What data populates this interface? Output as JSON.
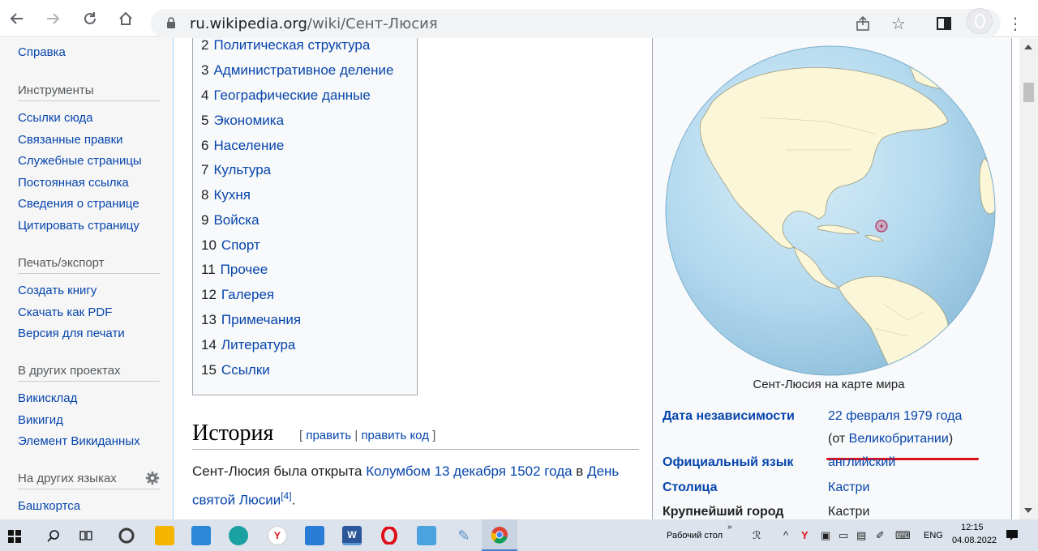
{
  "browser": {
    "url_domain": "ru.wikipedia.org",
    "url_path": "/wiki/Сент-Люсия"
  },
  "sidebar": {
    "help": "Справка",
    "tools_title": "Инструменты",
    "tools": [
      "Ссылки сюда",
      "Связанные правки",
      "Служебные страницы",
      "Постоянная ссылка",
      "Сведения о странице",
      "Цитировать страницу"
    ],
    "print_title": "Печать/экспорт",
    "print": [
      "Создать книгу",
      "Скачать как PDF",
      "Версия для печати"
    ],
    "projects_title": "В других проектах",
    "projects": [
      "Викисклад",
      "Викигид",
      "Элемент Викиданных"
    ],
    "languages_title": "На других языках",
    "languages": [
      "Башҡортса"
    ]
  },
  "toc": [
    {
      "num": "2",
      "text": "Политическая структура"
    },
    {
      "num": "3",
      "text": "Административное деление"
    },
    {
      "num": "4",
      "text": "Географические данные"
    },
    {
      "num": "5",
      "text": "Экономика"
    },
    {
      "num": "6",
      "text": "Население"
    },
    {
      "num": "7",
      "text": "Культура"
    },
    {
      "num": "8",
      "text": "Кухня"
    },
    {
      "num": "9",
      "text": "Войска"
    },
    {
      "num": "10",
      "text": "Спорт"
    },
    {
      "num": "11",
      "text": "Прочее"
    },
    {
      "num": "12",
      "text": "Галерея"
    },
    {
      "num": "13",
      "text": "Примечания"
    },
    {
      "num": "14",
      "text": "Литература"
    },
    {
      "num": "15",
      "text": "Ссылки"
    }
  ],
  "section": {
    "title": "История",
    "edit_open": "[",
    "edit": "править",
    "edit_sep": "|",
    "edit_code": "править код",
    "edit_close": "]"
  },
  "paragraph": {
    "t1": "Сент-Люсия была открыта ",
    "link1": "Колумбом",
    "t2": " ",
    "link2": "13 декабря",
    "t3": " ",
    "link3": "1502 года",
    "t4": " в ",
    "link4": "День святой Люсии",
    "ref": "[4]",
    "t5": "."
  },
  "infobox": {
    "caption": "Сент-Люсия на карте мира",
    "independence_label": "Дата независимости",
    "independence_value": "22 февраля 1979 года",
    "independence_from_open": "(от ",
    "independence_from": "Великобритании",
    "independence_from_close": ")",
    "language_label": "Официальный язык",
    "language_value": "английский",
    "capital_label": "Столица",
    "capital_value": "Кастри",
    "largest_city_label": "Крупнейший город",
    "largest_city_value": "Кастри"
  },
  "taskbar": {
    "desktop_label": "Рабочий стол",
    "lang": "ENG",
    "time": "12:15",
    "date": "04.08.2022"
  },
  "colors": {
    "link": "#0645ad",
    "accent_red": "#e0101a",
    "sidebar_bg": "#f6f6f6"
  }
}
